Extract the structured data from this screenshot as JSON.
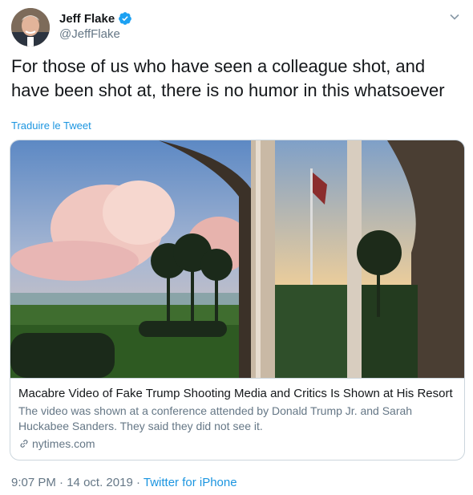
{
  "author": {
    "display_name": "Jeff Flake",
    "handle": "@JeffFlake"
  },
  "tweet": {
    "text": "For those of us who have seen a colleague shot, and have been shot at, there is no humor in this whatsoever",
    "translate_label": "Traduire le Tweet"
  },
  "card": {
    "title": "Macabre Video of Fake Trump Shooting Media and Critics Is Shown at His Resort",
    "description": "The video was shown at a conference attended by Donald Trump Jr. and Sarah Huckabee Sanders. They said they did not see it.",
    "domain": "nytimes.com"
  },
  "meta": {
    "time": "9:07 PM",
    "separator": " · ",
    "date": "14 oct. 2019",
    "separator2": " · ",
    "source": "Twitter for iPhone"
  },
  "colors": {
    "accent": "#1b95e0",
    "verified": "#1da1f2",
    "muted": "#657786"
  },
  "icons": [
    "verified-badge-icon",
    "chevron-down-icon",
    "link-icon"
  ]
}
